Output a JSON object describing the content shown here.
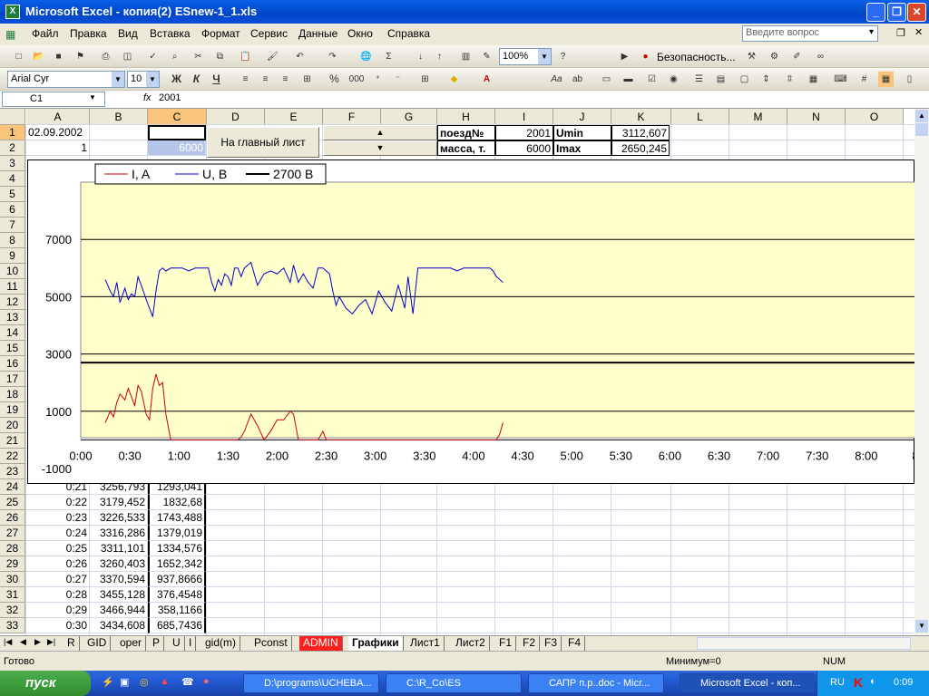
{
  "window": {
    "title": "Microsoft Excel - копия(2) ESnew-1_1.xls",
    "min": "_",
    "max": "❐",
    "close": "✕"
  },
  "menu": {
    "items": [
      "Файл",
      "Правка",
      "Вид",
      "Вставка",
      "Формат",
      "Сервис",
      "Данные",
      "Окно",
      "Справка"
    ],
    "ask_placeholder": "Введите вопрос"
  },
  "toolbar": {
    "zoom": "100%",
    "security_label": "Безопасность...",
    "font": "Arial Cyr",
    "size": "10",
    "bold": "Ж",
    "italic": "К",
    "underline": "Ч",
    "percent": "%",
    "thousands": "000"
  },
  "formula": {
    "cell": "C1",
    "fx": "fx",
    "value": "2001"
  },
  "columns": [
    "A",
    "B",
    "C",
    "D",
    "E",
    "F",
    "G",
    "H",
    "I",
    "J",
    "K",
    "L",
    "M",
    "N",
    "O"
  ],
  "rows": [
    "1",
    "2",
    "3",
    "4",
    "5",
    "6",
    "7",
    "8",
    "9",
    "10",
    "11",
    "12",
    "13",
    "14",
    "15",
    "16",
    "17",
    "18",
    "19",
    "20",
    "21",
    "22",
    "23",
    "24",
    "25",
    "26",
    "27",
    "28",
    "29",
    "30",
    "31",
    "32",
    "33"
  ],
  "cells": {
    "A1": "02.09.2002",
    "A2": "1",
    "C2": "6000",
    "H1": "поезд№",
    "I1": "2001",
    "J1": "Umin",
    "K1": "3112,607",
    "H2": "масса, т.",
    "I2": "6000",
    "J2": "Imax",
    "K2": "2650,245",
    "main_button": "На главный лист",
    "up": "▲",
    "down": "▼"
  },
  "table": [
    [
      "0:21",
      "3256,793",
      "1293,041"
    ],
    [
      "0:22",
      "3179,452",
      "1832,68"
    ],
    [
      "0:23",
      "3226,533",
      "1743,488"
    ],
    [
      "0:24",
      "3316,286",
      "1379,019"
    ],
    [
      "0:25",
      "3311,101",
      "1334,576"
    ],
    [
      "0:26",
      "3260,403",
      "1652,342"
    ],
    [
      "0:27",
      "3370,594",
      "937,8666"
    ],
    [
      "0:28",
      "3455,128",
      "376,4548"
    ],
    [
      "0:29",
      "3466,944",
      "358,1166"
    ],
    [
      "0:30",
      "3434,608",
      "685,7436"
    ]
  ],
  "chart_data": {
    "type": "line",
    "x_ticks": [
      "0:00",
      "0:30",
      "1:00",
      "1:30",
      "2:00",
      "2:30",
      "3:00",
      "3:30",
      "4:00",
      "4:30",
      "5:00",
      "5:30",
      "6:00",
      "6:30",
      "7:00",
      "7:30",
      "8:00",
      "8"
    ],
    "y_ticks": [
      "7000",
      "5000",
      "3000",
      "1000",
      "-1000"
    ],
    "ylim": [
      -1000,
      9000
    ],
    "xlim_min": [
      0,
      510
    ],
    "legend": [
      "I, A",
      "U, B",
      "2700 B"
    ],
    "colors": {
      "I": "#cc0000",
      "U": "#0000cc",
      "ref": "#000000",
      "plot_bg": "#ffffcc"
    },
    "series": [
      {
        "name": "U, B",
        "x": [
          15,
          18,
          20,
          22,
          24,
          27,
          29,
          31,
          33,
          35,
          37,
          40,
          42,
          44,
          46,
          48,
          50,
          52,
          55,
          58,
          62,
          66,
          70,
          74,
          78,
          80,
          82,
          84,
          86,
          88,
          90,
          92,
          94,
          96,
          98,
          100,
          104,
          108,
          112,
          116,
          120,
          124,
          128,
          130,
          133,
          136,
          139,
          142,
          145,
          148,
          150,
          152,
          154,
          156,
          158,
          162,
          166,
          170,
          174,
          178,
          182,
          186,
          190,
          194,
          198,
          200,
          203,
          206,
          210,
          214,
          218,
          222,
          226,
          230,
          234,
          238,
          242,
          246,
          250,
          252,
          254,
          256,
          258
        ],
        "y": [
          5600,
          5200,
          5000,
          5500,
          4800,
          5300,
          4900,
          5100,
          5000,
          5700,
          5400,
          4900,
          4600,
          4300,
          5200,
          5900,
          6000,
          5900,
          6000,
          6000,
          6000,
          5900,
          6000,
          6000,
          6000,
          5500,
          5200,
          5600,
          5400,
          5800,
          5700,
          5400,
          6000,
          6000,
          5700,
          6000,
          6200,
          5400,
          5800,
          5900,
          5800,
          6000,
          5500,
          6100,
          5500,
          5800,
          5500,
          5300,
          6000,
          6000,
          5900,
          5800,
          5200,
          4700,
          5000,
          4600,
          4400,
          4700,
          4900,
          4400,
          5200,
          4800,
          4500,
          5400,
          4600,
          5700,
          4400,
          6000,
          6000,
          6000,
          6000,
          6000,
          6000,
          5900,
          6000,
          6000,
          6000,
          6000,
          6000,
          5900,
          5700,
          5600,
          5500
        ]
      },
      {
        "name": "I, A",
        "x": [
          15,
          18,
          20,
          22,
          24,
          27,
          29,
          31,
          33,
          35,
          37,
          40,
          42,
          44,
          46,
          48,
          50,
          52,
          55,
          58,
          62,
          66,
          70,
          74,
          78,
          80,
          82,
          84,
          86,
          88,
          90,
          92,
          94,
          96,
          98,
          100,
          104,
          108,
          112,
          116,
          120,
          124,
          128,
          130,
          133,
          136,
          139,
          142,
          145,
          148,
          150,
          152,
          154,
          156,
          158,
          162,
          166,
          170,
          174,
          178,
          182,
          186,
          190,
          194,
          198,
          200,
          203,
          206,
          210,
          214,
          218,
          222,
          226,
          230,
          234,
          238,
          242,
          246,
          250,
          252,
          254,
          256,
          258
        ],
        "y": [
          600,
          1000,
          800,
          1300,
          1600,
          1400,
          1800,
          1500,
          1200,
          1900,
          1700,
          900,
          700,
          1800,
          2300,
          1900,
          2000,
          900,
          0,
          0,
          0,
          0,
          0,
          0,
          0,
          0,
          0,
          0,
          0,
          0,
          0,
          0,
          0,
          0,
          100,
          300,
          900,
          500,
          0,
          300,
          700,
          700,
          1000,
          900,
          0,
          0,
          0,
          0,
          0,
          300,
          0,
          0,
          0,
          0,
          0,
          0,
          0,
          0,
          0,
          0,
          0,
          0,
          0,
          0,
          0,
          0,
          0,
          0,
          0,
          0,
          0,
          0,
          0,
          0,
          0,
          0,
          0,
          0,
          0,
          0,
          0,
          200,
          600
        ]
      },
      {
        "name": "2700 B",
        "x": [
          0,
          510
        ],
        "y": [
          2700,
          2700
        ]
      }
    ]
  },
  "sheets": [
    "R",
    "GID",
    "oper",
    "P",
    "U",
    "I",
    "gid(m)",
    "Pconst",
    "ADMIN",
    "Графики",
    "Лист1",
    "Лист2",
    "F1",
    "F2",
    "F3",
    "F4"
  ],
  "active_sheet": "Графики",
  "status": {
    "ready": "Готово",
    "min": "Минимум=0",
    "num": "NUM"
  },
  "taskbar": {
    "start": "пуск",
    "tasks": [
      "D:\\programs\\UCHEBA...",
      "C:\\R_Co\\ES",
      "САПР п.р..doc - Micr...",
      "Microsoft Excel - коп..."
    ],
    "lang": "RU",
    "clock": "0:09"
  }
}
